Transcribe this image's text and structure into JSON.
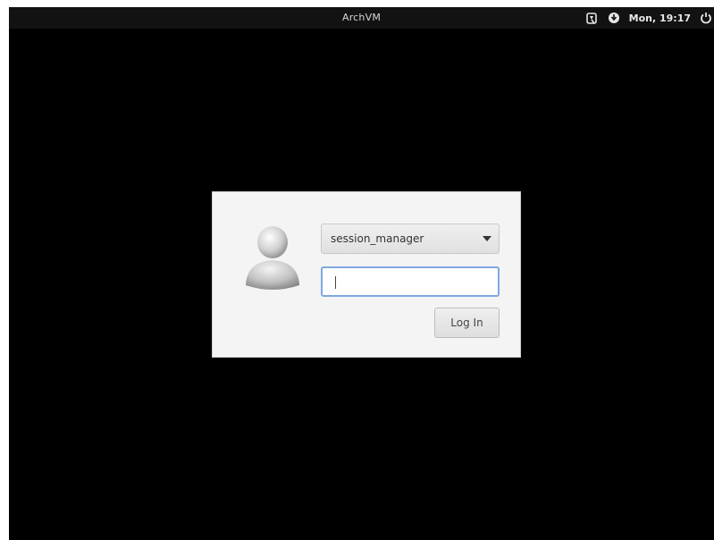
{
  "topbar": {
    "title": "ArchVM",
    "clock": "Mon, 19:17",
    "icons": [
      "accessibility-icon",
      "network-icon",
      "power-icon"
    ]
  },
  "login": {
    "session_selected": "session_manager",
    "password_value": "",
    "login_label": "Log In",
    "focus_color": "#7fa8e0"
  }
}
